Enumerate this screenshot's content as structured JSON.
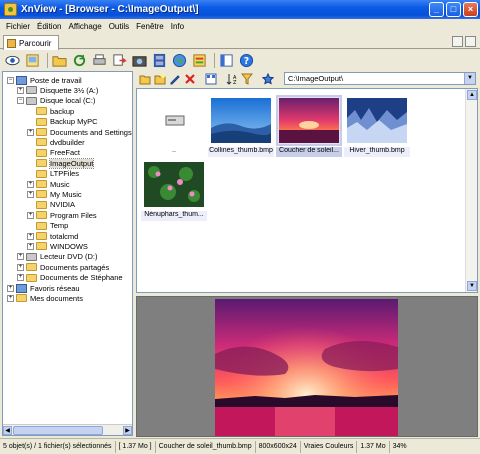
{
  "window": {
    "title": "XnView - [Browser - C:\\ImageOutput\\]",
    "controls": [
      "_",
      "□",
      "×"
    ]
  },
  "menu": [
    "Fichier",
    "Édition",
    "Affichage",
    "Outils",
    "Fenêtre",
    "Info"
  ],
  "tab": {
    "label": "Parcourir"
  },
  "toolbar": {
    "icons": [
      "eye-icon",
      "browse-icon",
      "open-folder-icon",
      "refresh-icon",
      "print-icon",
      "convert-icon",
      "camera-icon",
      "filmstrip-icon",
      "globe-icon",
      "options-icon",
      "panel-icon",
      "help-icon"
    ]
  },
  "tree": {
    "items": [
      {
        "label": "Poste de travail",
        "level": 0,
        "icon": "computer"
      },
      {
        "label": "Disquette 3½ (A:)",
        "level": 1,
        "icon": "drive"
      },
      {
        "label": "Disque local (C:)",
        "level": 1,
        "icon": "drive"
      },
      {
        "label": "backup",
        "level": 2,
        "icon": "folder"
      },
      {
        "label": "Backup MyPC",
        "level": 2,
        "icon": "folder"
      },
      {
        "label": "Documents and Settings",
        "level": 2,
        "icon": "folder"
      },
      {
        "label": "dvdbuilder",
        "level": 2,
        "icon": "folder"
      },
      {
        "label": "FreeFact",
        "level": 2,
        "icon": "folder"
      },
      {
        "label": "ImageOutput",
        "level": 2,
        "icon": "folder",
        "selected": true
      },
      {
        "label": "LTPFiles",
        "level": 2,
        "icon": "folder"
      },
      {
        "label": "Music",
        "level": 2,
        "icon": "folder"
      },
      {
        "label": "My Music",
        "level": 2,
        "icon": "folder"
      },
      {
        "label": "NVIDIA",
        "level": 2,
        "icon": "folder"
      },
      {
        "label": "Program Files",
        "level": 2,
        "icon": "folder"
      },
      {
        "label": "Temp",
        "level": 2,
        "icon": "folder"
      },
      {
        "label": "totalcmd",
        "level": 2,
        "icon": "folder"
      },
      {
        "label": "WINDOWS",
        "level": 2,
        "icon": "folder"
      },
      {
        "label": "Lecteur DVD (D:)",
        "level": 1,
        "icon": "drive"
      },
      {
        "label": "Documents partagés",
        "level": 1,
        "icon": "folder"
      },
      {
        "label": "Documents de Stéphane",
        "level": 1,
        "icon": "folder"
      },
      {
        "label": "Favoris réseau",
        "level": 0,
        "icon": "computer"
      },
      {
        "label": "Mes documents",
        "level": 0,
        "icon": "folder"
      }
    ]
  },
  "browser": {
    "path": "C:\\ImageOutput\\",
    "thumbnails": [
      {
        "caption": "..",
        "kind": "parent"
      },
      {
        "caption": "Collines_thumb.bmp",
        "kind": "hills"
      },
      {
        "caption": "Coucher de soleil...",
        "kind": "sunset",
        "selected": true
      },
      {
        "caption": "Hiver_thumb.bmp",
        "kind": "winter"
      },
      {
        "caption": "Nénuphars_thum...",
        "kind": "lilies"
      }
    ]
  },
  "status": {
    "selection": "5 objet(s) / 1 fichier(s) sélectionnés",
    "total_size": "[ 1.37 Mo ]",
    "filename": "Coucher de soleil_thumb.bmp",
    "dimensions": "800x600x24",
    "color_mode": "Vraies Couleurs",
    "file_size": "1.37 Mo",
    "zoom": "34%"
  },
  "colors": {
    "titlebar": "#0a5ae6",
    "selection": "#c8cde8",
    "preview_bg": "#7f7f7f"
  }
}
